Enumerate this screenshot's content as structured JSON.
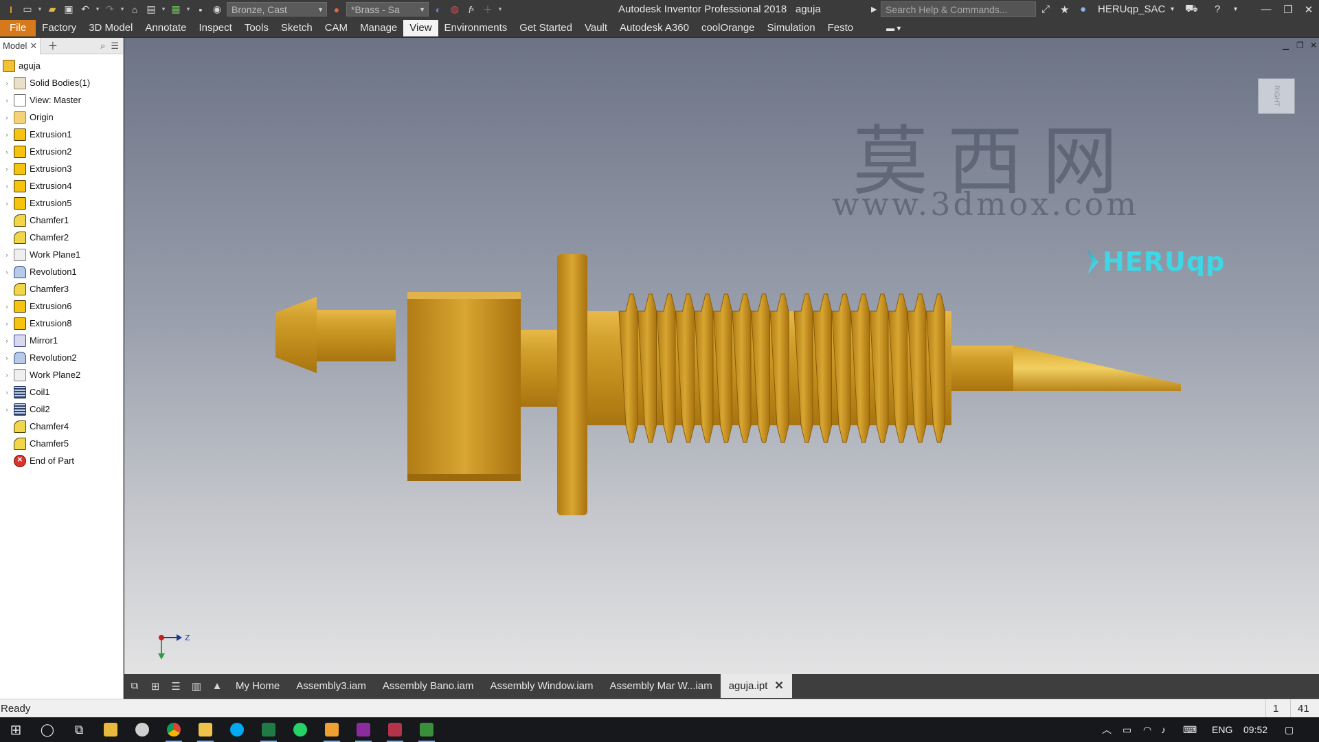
{
  "titlebar": {
    "app_title": "Autodesk Inventor Professional 2018",
    "document_name": "aguja",
    "material": "Bronze, Cast",
    "appearance": "*Brass - Sa",
    "search_placeholder": "Search Help & Commands...",
    "user_name": "HERUqp_SAC"
  },
  "ribbon": {
    "tabs": [
      "File",
      "Factory",
      "3D Model",
      "Annotate",
      "Inspect",
      "Tools",
      "Sketch",
      "CAM",
      "Manage",
      "View",
      "Environments",
      "Get Started",
      "Vault",
      "Autodesk A360",
      "coolOrange",
      "Simulation",
      "Festo"
    ],
    "active_tab": "View"
  },
  "browser": {
    "tab_label": "Model",
    "items": [
      {
        "label": "aguja",
        "icon": "part-icon",
        "expandable": false,
        "indent": 0
      },
      {
        "label": "Solid Bodies(1)",
        "icon": "solid-bodies-icon",
        "expandable": true
      },
      {
        "label": "View: Master",
        "icon": "view-icon",
        "expandable": true
      },
      {
        "label": "Origin",
        "icon": "folder-icon",
        "expandable": true
      },
      {
        "label": "Extrusion1",
        "icon": "extrusion-icon",
        "expandable": true
      },
      {
        "label": "Extrusion2",
        "icon": "extrusion-icon",
        "expandable": true
      },
      {
        "label": "Extrusion3",
        "icon": "extrusion-icon",
        "expandable": true
      },
      {
        "label": "Extrusion4",
        "icon": "extrusion-icon",
        "expandable": true
      },
      {
        "label": "Extrusion5",
        "icon": "extrusion-icon",
        "expandable": true
      },
      {
        "label": "Chamfer1",
        "icon": "chamfer-icon",
        "expandable": false
      },
      {
        "label": "Chamfer2",
        "icon": "chamfer-icon",
        "expandable": false
      },
      {
        "label": "Work Plane1",
        "icon": "work-plane-icon",
        "expandable": true
      },
      {
        "label": "Revolution1",
        "icon": "revolution-icon",
        "expandable": true
      },
      {
        "label": "Chamfer3",
        "icon": "chamfer-icon",
        "expandable": false
      },
      {
        "label": "Extrusion6",
        "icon": "extrusion-icon",
        "expandable": true
      },
      {
        "label": "Extrusion8",
        "icon": "extrusion-icon",
        "expandable": true
      },
      {
        "label": "Mirror1",
        "icon": "mirror-icon",
        "expandable": true
      },
      {
        "label": "Revolution2",
        "icon": "revolution-icon",
        "expandable": true
      },
      {
        "label": "Work Plane2",
        "icon": "work-plane-icon",
        "expandable": true
      },
      {
        "label": "Coil1",
        "icon": "coil-icon",
        "expandable": true
      },
      {
        "label": "Coil2",
        "icon": "coil-icon",
        "expandable": true
      },
      {
        "label": "Chamfer4",
        "icon": "chamfer-icon",
        "expandable": false
      },
      {
        "label": "Chamfer5",
        "icon": "chamfer-icon",
        "expandable": false
      },
      {
        "label": "End of Part",
        "icon": "end-of-part-icon",
        "expandable": false
      }
    ]
  },
  "viewport": {
    "viewcube_face": "RIGHT",
    "watermark_cn": "莫西网",
    "watermark_url": "www.3dmox.com",
    "brand_logo": "HERUqp",
    "triad_axis_label": "Z",
    "part_color": "#c9971f"
  },
  "doc_tabs": {
    "tabs": [
      "My Home",
      "Assembly3.iam",
      "Assembly Bano.iam",
      "Assembly Window.iam",
      "Assembly Mar W...iam",
      "aguja.ipt"
    ],
    "active_tab": "aguja.ipt"
  },
  "statusbar": {
    "status": "Ready",
    "count_a": "1",
    "count_b": "41"
  },
  "taskbar": {
    "language": "ENG",
    "time": "09:52"
  }
}
